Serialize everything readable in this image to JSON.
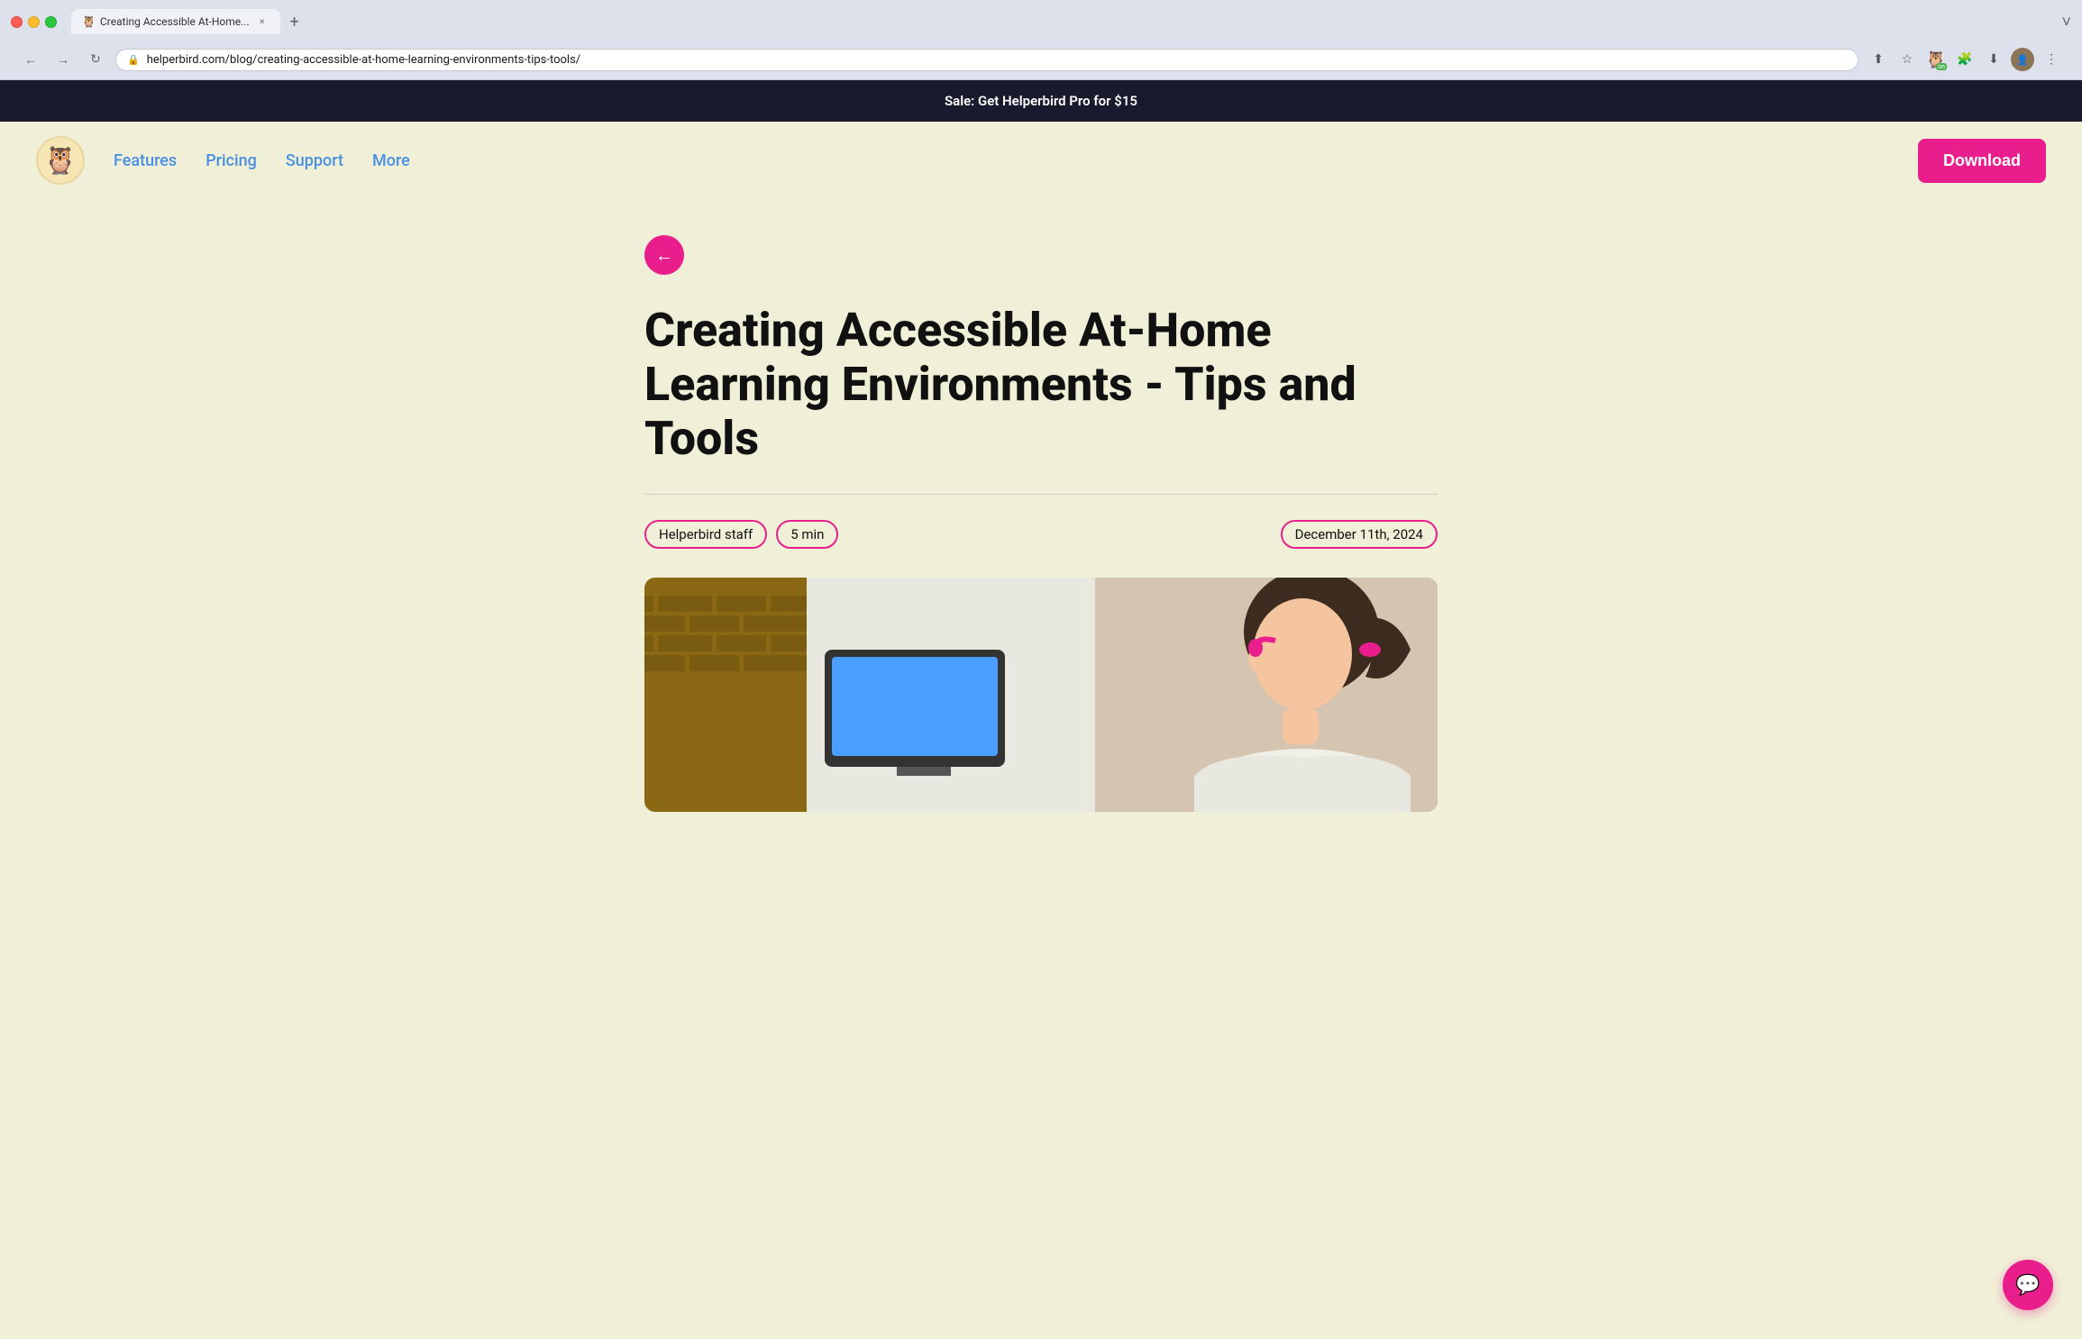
{
  "browser": {
    "tab_favicon": "🦉",
    "tab_title": "Creating Accessible At-Home...",
    "tab_close": "×",
    "new_tab": "+",
    "back_tooltip": "Back",
    "forward_tooltip": "Forward",
    "reload_tooltip": "Reload",
    "address": "helperbird.com/blog/creating-accessible-at-home-learning-environments-tips-tools/",
    "chevron_down": "˅"
  },
  "announcement": {
    "text": "Sale: Get Helperbird Pro for $15"
  },
  "nav": {
    "logo_emoji": "🦉",
    "links": [
      {
        "label": "Features",
        "id": "features"
      },
      {
        "label": "Pricing",
        "id": "pricing"
      },
      {
        "label": "Support",
        "id": "support"
      },
      {
        "label": "More",
        "id": "more"
      }
    ],
    "download_label": "Download"
  },
  "article": {
    "back_arrow": "←",
    "title": "Creating Accessible At-Home Learning Environments - Tips and Tools",
    "author_tag": "Helperbird staff",
    "time_tag": "5 min",
    "date_tag": "December 11th, 2024"
  },
  "chat": {
    "icon": "💬"
  }
}
